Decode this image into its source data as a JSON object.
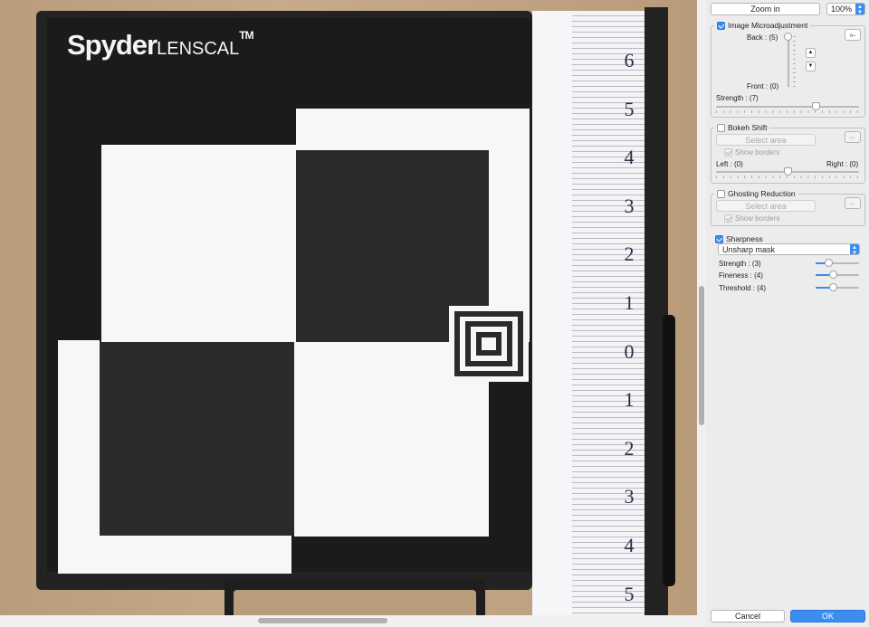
{
  "preview": {
    "logo_main": "Spyder",
    "logo_sub": "LENSCAL",
    "logo_tm": "TM",
    "ruler_marks": [
      "6",
      "5",
      "4",
      "3",
      "2",
      "1",
      "0",
      "1",
      "2",
      "3",
      "4",
      "5"
    ]
  },
  "toolbar": {
    "zoom_in_label": "Zoom in",
    "zoom_value": "100%"
  },
  "image_micro": {
    "label": "Image Microadjustment",
    "checked": true,
    "back_label": "Back : (5)",
    "front_label": "Front : (0)",
    "strength_label": "Strength : (7)",
    "strength_fraction": 0.7
  },
  "bokeh": {
    "label": "Bokeh Shift",
    "checked": false,
    "select_area": "Select area",
    "show_borders": "Show borders",
    "left_label": "Left : (0)",
    "right_label": "Right : (0)"
  },
  "ghosting": {
    "label": "Ghosting Reduction",
    "checked": false,
    "select_area": "Select area",
    "show_borders": "Show borders"
  },
  "sharpness": {
    "label": "Sharpness",
    "checked": true,
    "method": "Unsharp mask",
    "strength_label": "Strength : (3)",
    "fineness_label": "Fineness : (4)",
    "threshold_label": "Threshold : (4)",
    "strength_fraction": 0.3,
    "fineness_fraction": 0.4,
    "threshold_fraction": 0.4
  },
  "footer": {
    "cancel_label": "Cancel",
    "ok_label": "OK"
  },
  "colors": {
    "accent": "#3b8df0"
  }
}
